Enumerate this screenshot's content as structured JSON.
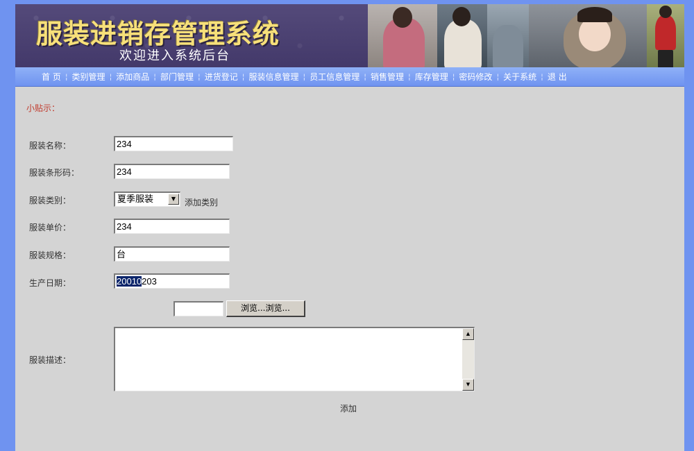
{
  "banner": {
    "title": "服装进销存管理系统",
    "subtitle": "欢迎进入系统后台"
  },
  "nav": {
    "items": [
      "首 页",
      "类别管理",
      "添加商品",
      "部门管理",
      "进货登记",
      "服装信息管理",
      "员工信息管理",
      "销售管理",
      "库存管理",
      "密码修改",
      "关于系统",
      "退 出"
    ]
  },
  "tip": "小贴示：",
  "form": {
    "name_label": "服装名称：",
    "name_value": "234",
    "barcode_label": "服装条形码：",
    "barcode_value": "234",
    "category_label": "服装类别：",
    "category_value": "夏季服装",
    "add_category_link": "添加类别",
    "price_label": "服装单价：",
    "price_value": "234",
    "spec_label": "服装规格：",
    "spec_value": "台",
    "date_label": "生产日期：",
    "date_selected": "20010",
    "date_rest": "203",
    "browse_label": "浏览...浏览...",
    "description_label": "服装描述：",
    "submit_label": "添加"
  },
  "colors": {
    "page_bg": "#6f93f0",
    "content_bg": "#d4d4d4",
    "banner_title": "#f7e07a",
    "tip_red": "#c0392b",
    "selection": "#0a246a"
  }
}
